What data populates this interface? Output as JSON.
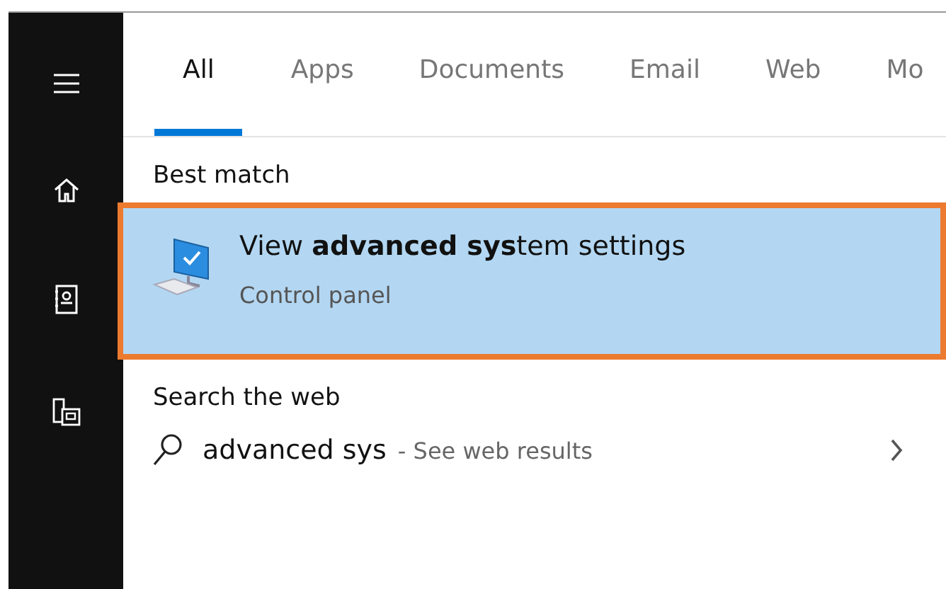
{
  "sidebar": {
    "items": [
      {
        "kind": "menu"
      },
      {
        "kind": "home"
      },
      {
        "kind": "notebook"
      },
      {
        "kind": "devices"
      }
    ]
  },
  "tabs": [
    {
      "label": "All",
      "selected": true
    },
    {
      "label": "Apps",
      "selected": false
    },
    {
      "label": "Documents",
      "selected": false
    },
    {
      "label": "Email",
      "selected": false
    },
    {
      "label": "Web",
      "selected": false
    },
    {
      "label": "Mo",
      "selected": false
    }
  ],
  "best_match": {
    "heading": "Best match",
    "result": {
      "title": "View **advanced sys**tem settings",
      "subtitle": "Control panel",
      "selected": true
    }
  },
  "web": {
    "heading": "Search the web",
    "query": "advanced sys",
    "suffix": "- See web results"
  }
}
